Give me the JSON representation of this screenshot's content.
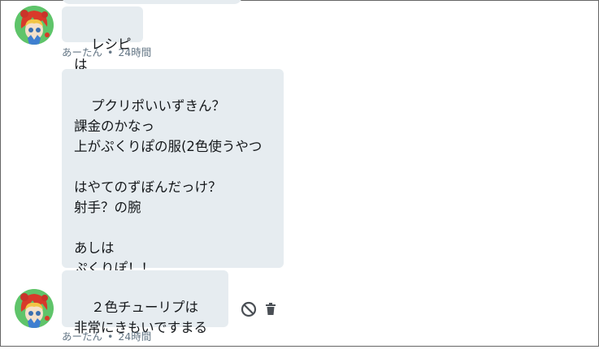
{
  "messages": [
    {
      "text": "レシピは",
      "author": "あーたん",
      "time": "24時間"
    },
    {
      "text": "プクリポいいずきん？\n課金のかなっ\n上がぷくりぽの服(2色使うやつ\n\nはやてのずぼんだっけ？\n射手？の腕\n\nあしは\nぷくりぽ！！"
    },
    {
      "text": "２色チューリプは\n非常にきもいですまる",
      "author": "あーたん",
      "time": "24時間"
    }
  ],
  "meta_separator": "•",
  "icons": {
    "avatar": "avatar-image",
    "block": "block-icon",
    "delete": "trash-icon"
  },
  "colors": {
    "bubble": "#e6ecf0",
    "text": "#14171a",
    "meta": "#657786",
    "icon": "#4a4f55"
  }
}
